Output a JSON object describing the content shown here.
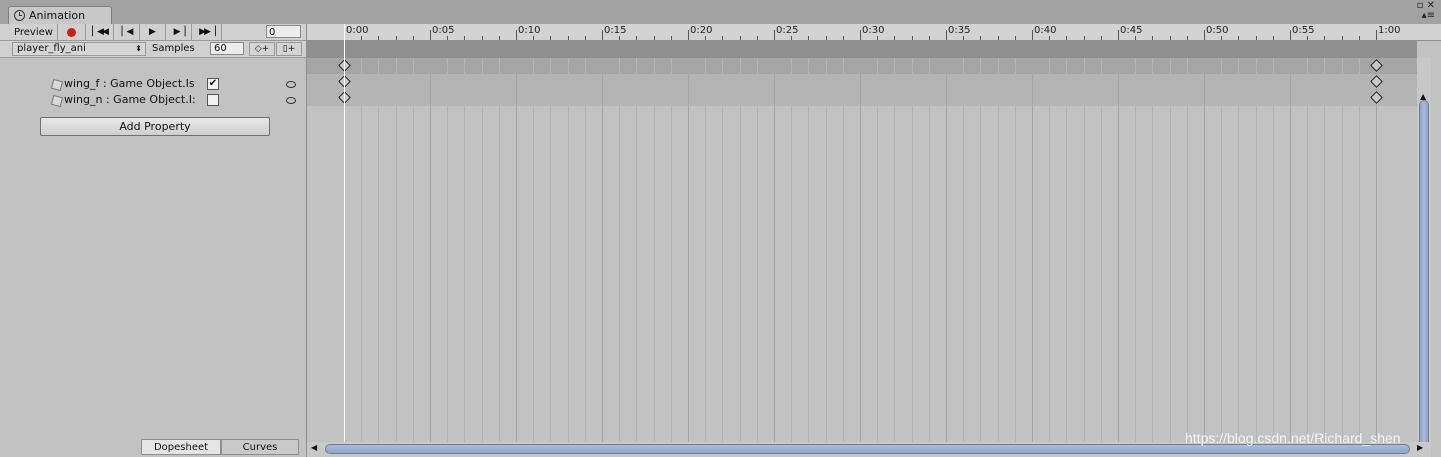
{
  "window": {
    "tab_title": "Animation",
    "icons": [
      "restore-icon",
      "close-icon",
      "menu-icon"
    ]
  },
  "toolbar": {
    "preview_label": "Preview",
    "current_frame": "0",
    "clip_name": "player_fly_ani",
    "samples_label": "Samples",
    "samples_value": "60",
    "add_keyframe_glyph": "◇+",
    "add_event_glyph": "▯+"
  },
  "properties": [
    {
      "name": "wing_f : Game Object.Is",
      "checked": true,
      "check_glyph": "✔"
    },
    {
      "name": "wing_n : Game Object.I:",
      "checked": false,
      "check_glyph": ""
    }
  ],
  "add_property_label": "Add Property",
  "bottom_tabs": {
    "dopesheet": "Dopesheet",
    "curves": "Curves"
  },
  "timeline": {
    "time_labels": [
      "0:00",
      "0:05",
      "0:10",
      "0:15",
      "0:20",
      "0:25",
      "0:30",
      "0:35",
      "0:40",
      "0:45",
      "0:50",
      "0:55",
      "1:00"
    ],
    "keyframe_times_frames": [
      0,
      60
    ],
    "playhead_frame": 0
  },
  "watermark": "https://blog.csdn.net/Richard_shen"
}
